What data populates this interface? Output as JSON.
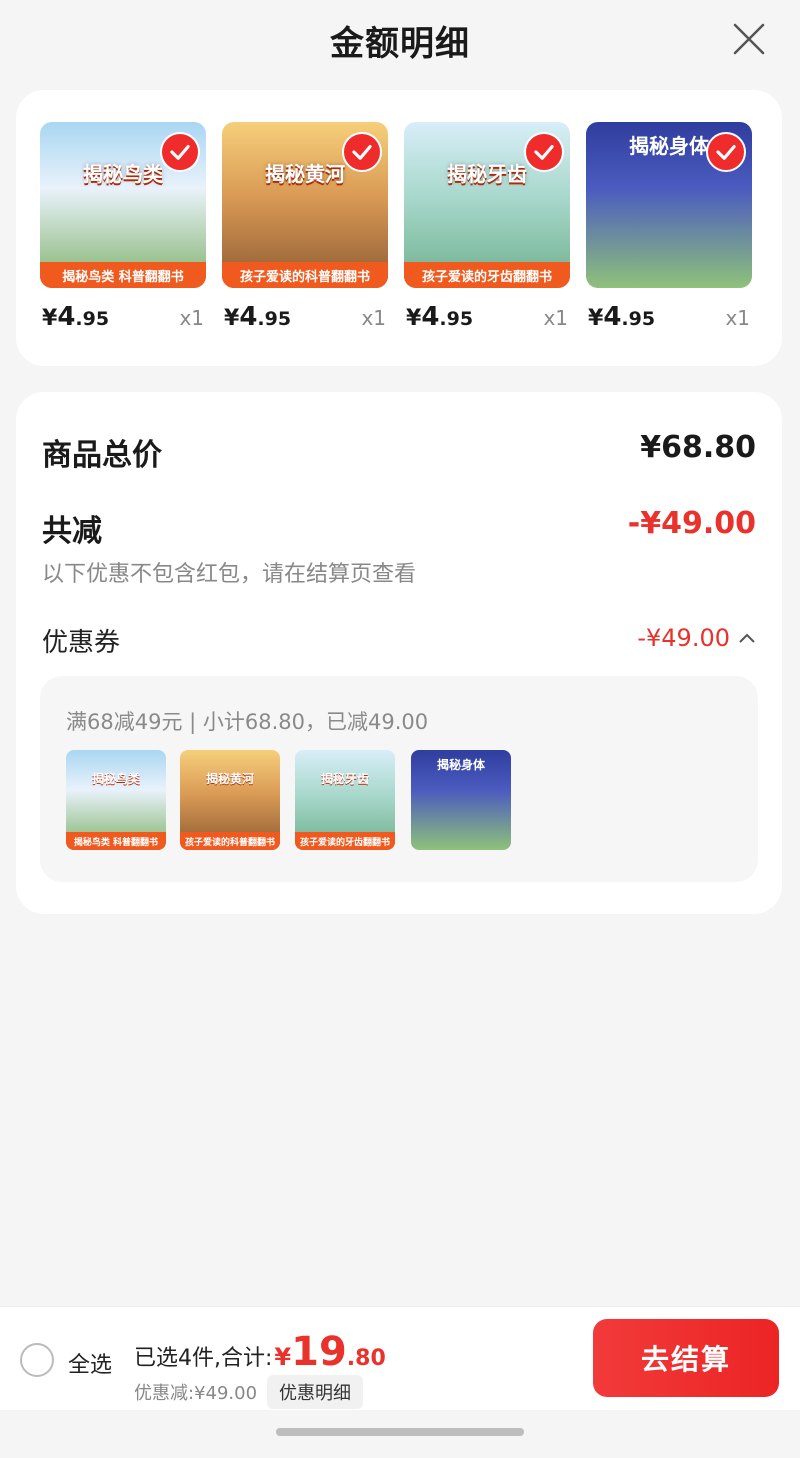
{
  "header": {
    "title": "金额明细",
    "close_icon": "close-icon"
  },
  "products": [
    {
      "title": "揭秘鸟类",
      "ribbon": "揭秘鸟类 科普翻翻书",
      "price_symbol": "¥",
      "price_int": "4",
      "price_dec": ".95",
      "qty": "x1",
      "selected": true,
      "colors": {
        "bg": "#e7f0fb",
        "top": "#9fd2f0"
      }
    },
    {
      "title": "揭秘黄河",
      "ribbon": "孩子爱读的科普翻翻书",
      "price_symbol": "¥",
      "price_int": "4",
      "price_dec": ".95",
      "qty": "x1",
      "selected": true,
      "colors": {
        "bg": "#c98a4d",
        "top": "#f2c16b"
      }
    },
    {
      "title": "揭秘牙齿",
      "ribbon": "孩子爱读的牙齿翻翻书",
      "price_symbol": "¥",
      "price_int": "4",
      "price_dec": ".95",
      "qty": "x1",
      "selected": true,
      "colors": {
        "bg": "#9ed0c6",
        "top": "#cfe8f4"
      }
    },
    {
      "title": "揭秘身体",
      "ribbon": "",
      "price_symbol": "¥",
      "price_int": "4",
      "price_dec": ".95",
      "qty": "x1",
      "selected": true,
      "colors": {
        "bg": "#3f4fb4",
        "top": "#2e3c9c"
      }
    }
  ],
  "summary": {
    "total_label": "商品总价",
    "total_value": "¥68.80",
    "reduce_label": "共减",
    "reduce_value": "-¥49.00",
    "note": "以下优惠不包含红包，请在结算页查看",
    "coupon_label": "优惠券",
    "coupon_value": "-¥49.00",
    "coupon_toggle_icon": "chevron-up-icon",
    "coupon_desc": "满68减49元 | 小计68.80，已减49.00"
  },
  "bottom_bar": {
    "select_all": "全选",
    "total_label": "已选4件,合计:",
    "total_symbol": "¥",
    "total_int": "19",
    "total_dec": ".80",
    "discount_text": "优惠减:¥49.00",
    "detail_button": "优惠明细",
    "checkout_button": "去结算"
  },
  "colors": {
    "accent_red": "#e8322b",
    "checkout_red": "#ef2b2b",
    "ribbon_orange": "#f05a1e"
  }
}
